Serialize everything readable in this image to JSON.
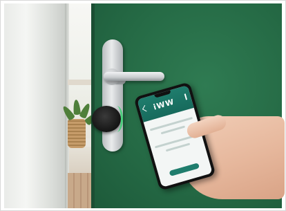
{
  "photo": {
    "app_logo_text": "iWW",
    "accent_colors": {
      "door_green": "#256a45",
      "app_teal": "#1f7d6d",
      "lock_indicator": "#46d07a",
      "skin": "#e6b79c"
    }
  }
}
